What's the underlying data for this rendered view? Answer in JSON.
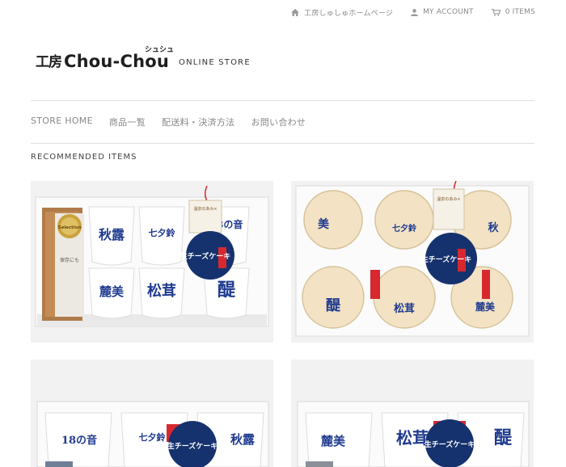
{
  "topbar": {
    "home_label": "工房しゅしゅホームページ",
    "account_label": "MY ACCOUNT",
    "cart_label": "0 ITEMS"
  },
  "logo": {
    "kanji": "工房",
    "name": "Chou-Chou",
    "ruby": "シュシュ",
    "store_label": "ONLINE STORE"
  },
  "nav": {
    "items": [
      "STORE HOME",
      "商品一覧",
      "配送料・決済方法",
      "お問い合わせ"
    ]
  },
  "section": {
    "title": "RECOMMENDED ITEMS"
  },
  "products": [
    {
      "cup_labels": [
        "秋露",
        "七夕鈴",
        "18の音",
        "麓美",
        "松茸",
        "醍"
      ],
      "tag_text": "生チーズケーキ",
      "tag_upper": "温泉のあみ×",
      "medal_text": "Selection",
      "packet_text": "保存にも"
    },
    {
      "cup_labels": [
        "美",
        "七夕鈴",
        "秋",
        "醍",
        "松茸",
        "麓美"
      ],
      "tag_text": "生チーズケーキ",
      "tag_upper": "温泉のあみ×"
    },
    {
      "cup_labels": [
        "18の音",
        "七夕鈴",
        "秋露"
      ],
      "tag_text": "生チーズケーキ"
    },
    {
      "cup_labels": [
        "麓美",
        "松茸",
        "醍"
      ],
      "tag_text": "生チーズケーキ"
    }
  ],
  "colors": {
    "text_muted": "#888888",
    "divider": "#dedede",
    "ink_blue": "#1f3a8f",
    "tag_navy": "#16326e",
    "ribbon_red": "#d7282f"
  }
}
